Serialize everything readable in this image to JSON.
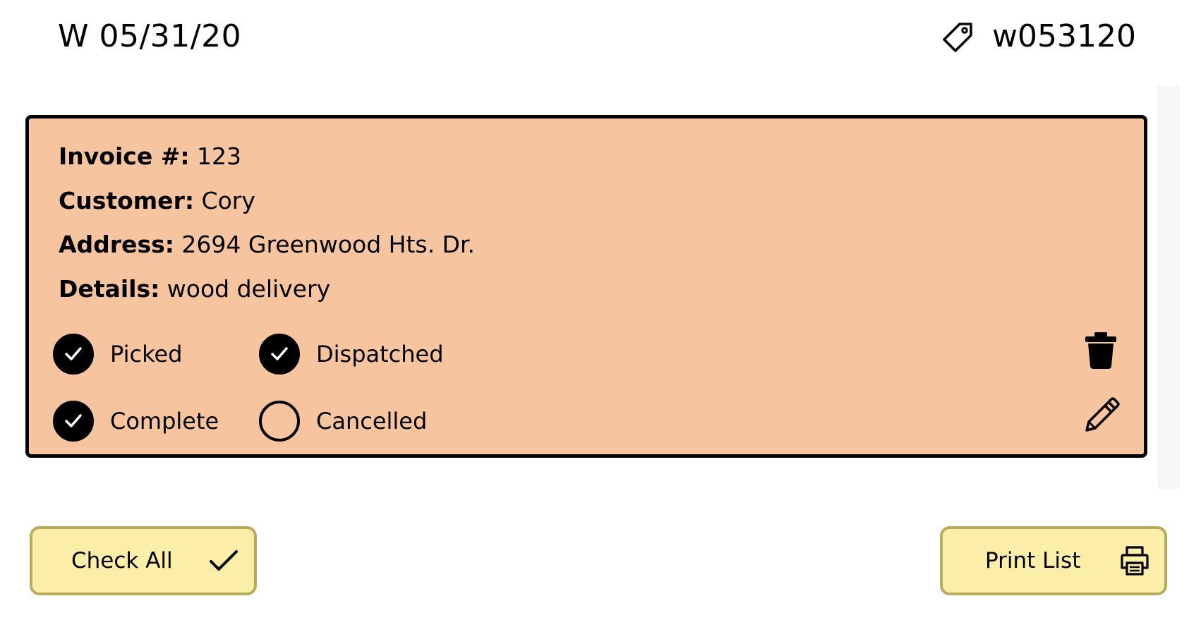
{
  "header": {
    "title": "W 05/31/20",
    "tag_icon": "tag-icon",
    "tag_label": "w053120"
  },
  "order": {
    "invoice": {
      "label": "Invoice #:",
      "value": "123"
    },
    "customer": {
      "label": "Customer:",
      "value": "Cory"
    },
    "address": {
      "label": "Address:",
      "value": "2694 Greenwood Hts. Dr."
    },
    "details": {
      "label": "Details:",
      "value": "wood delivery"
    },
    "card_color": "#f7c4a0",
    "statuses": [
      {
        "label": "Picked",
        "checked": true
      },
      {
        "label": "Dispatched",
        "checked": true
      },
      {
        "label": "Complete",
        "checked": true
      },
      {
        "label": "Cancelled",
        "checked": false
      }
    ],
    "actions": {
      "delete_icon": "trash-icon",
      "edit_icon": "pencil-icon"
    }
  },
  "footer": {
    "check_all_label": "Check All",
    "check_all_icon": "checkmark-icon",
    "print_label": "Print List",
    "print_icon": "printer-icon",
    "button_color": "#fbeea9"
  }
}
